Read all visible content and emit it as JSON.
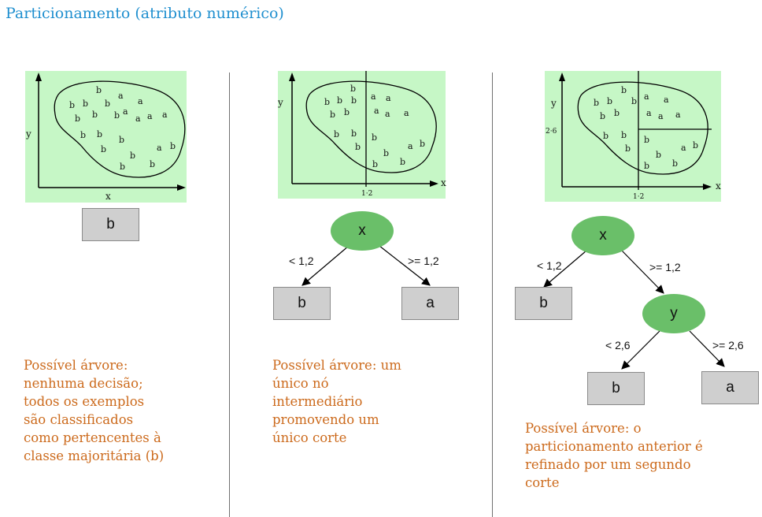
{
  "title": "Particionamento (atributo numérico)",
  "colors": {
    "title": "#1f8fcf",
    "panel_bg": "#c6f7c6",
    "node_fill": "#6abf69",
    "leaf_fill": "#cfcfcf",
    "description": "#cc6a1c"
  },
  "panel1": {
    "x_label": "x",
    "y_label": "y",
    "b_letters": "b",
    "a_letters": "a",
    "leaf": "b",
    "description": [
      "Possível árvore:",
      "nenhuma decisão;",
      "todos os exemplos",
      "são classificados",
      "como pertencentes à",
      "classe majoritária (b)"
    ]
  },
  "panel2": {
    "x_label": "x",
    "y_label": "y",
    "x_tick": "1·2",
    "root": "x",
    "left_edge": "< 1,2",
    "right_edge": ">= 1,2",
    "left_leaf": "b",
    "right_leaf": "a",
    "description": [
      "Possível árvore: um",
      "único nó",
      "intermediário",
      "promovendo um",
      "único corte"
    ]
  },
  "panel3": {
    "x_label": "x",
    "y_label": "y",
    "x_tick": "1·2",
    "y_tick": "2·6",
    "root": "x",
    "left_edge": "< 1,2",
    "right_edge": ">= 1,2",
    "left_leaf": "b",
    "inner": "y",
    "inner_left_edge": "< 2,6",
    "inner_right_edge": ">= 2,6",
    "inner_left_leaf": "b",
    "inner_right_leaf": "a",
    "description": [
      "Possível árvore: o",
      "particionamento anterior é",
      "refinado por um segundo",
      "corte"
    ]
  }
}
